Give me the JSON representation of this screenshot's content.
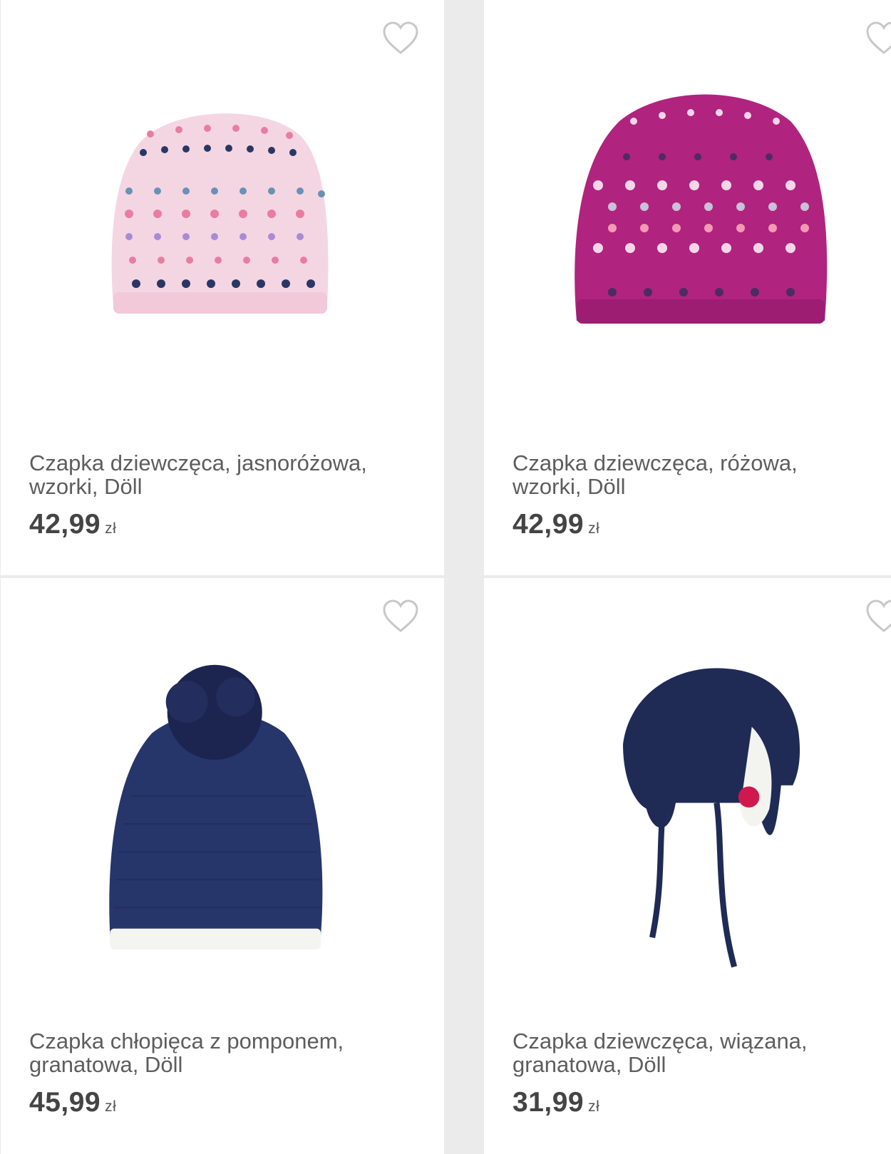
{
  "products": [
    {
      "title": "Czapka dziewczęca, jasnoróżowa, wzorki, Döll",
      "price": "42,99",
      "currency": "zł",
      "image_icon": "beanie-light-pink-pattern",
      "favorite_icon": "heart-outline-icon"
    },
    {
      "title": "Czapka dziewczęca, różowa, wzorki, Döll",
      "price": "42,99",
      "currency": "zł",
      "image_icon": "beanie-magenta-pattern",
      "favorite_icon": "heart-outline-icon"
    },
    {
      "title": "Czapka chłopięca z pomponem, granatowa, Döll",
      "price": "45,99",
      "currency": "zł",
      "image_icon": "beanie-navy-pompom",
      "favorite_icon": "heart-outline-icon"
    },
    {
      "title": "Czapka dziewczęca, wiązana, granatowa, Döll",
      "price": "31,99",
      "currency": "zł",
      "image_icon": "hat-navy-earflaps-ties",
      "favorite_icon": "heart-outline-icon"
    }
  ],
  "colors": {
    "background": "#ebebeb",
    "card": "#ffffff",
    "title_text": "#5d5d5d",
    "price_text": "#444444",
    "heart_outline": "#c8c8c8",
    "light_pink_hat": "#f4d6e2",
    "magenta_hat": "#b0237f",
    "navy_hat": "#1f2b55"
  }
}
